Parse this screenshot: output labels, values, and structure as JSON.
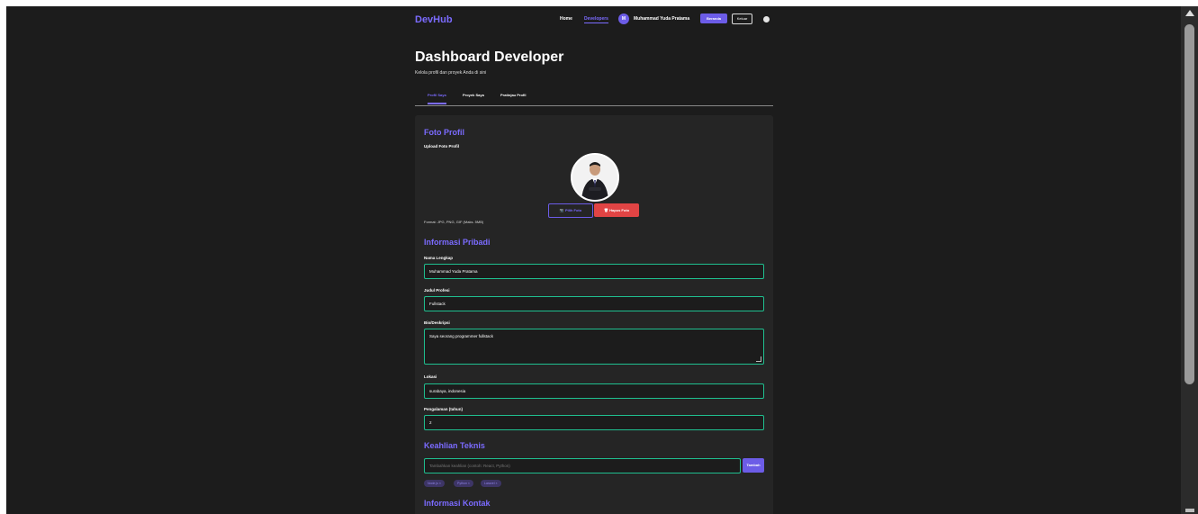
{
  "nav": {
    "logo": "DevHub",
    "home": "Home",
    "developers": "Developers",
    "avatar_initial": "M",
    "user_name": "Muhammad Yuda Pratama",
    "beranda": "Beranda",
    "keluar": "Keluar"
  },
  "header": {
    "title": "Dashboard Developer",
    "subtitle": "Kelola profil dan proyek Anda di sini"
  },
  "tabs": [
    "Profil Saya",
    "Proyek Saya",
    "Pratinjau Profil"
  ],
  "photo": {
    "heading": "Foto Profil",
    "upload_label": "Upload Foto Profil",
    "choose_button": "Pilih Foto",
    "delete_button": "Hapus Foto",
    "format_note": "Format: JPG, PNG, GIF (Maks. 5MB)"
  },
  "personal": {
    "heading": "Informasi Pribadi",
    "name_label": "Nama Lengkap",
    "name_value": "Muhammad Yuda Pratama",
    "title_label": "Judul Profesi",
    "title_value": "Fullstack",
    "bio_label": "Bio/Deskripsi",
    "bio_value": "Saya seorang programmer fullstack",
    "location_label": "Lokasi",
    "location_value": "surabaya, indonesia",
    "experience_label": "Pengalaman (tahun)",
    "experience_value": "2"
  },
  "skills": {
    "heading": "Keahlian Teknis",
    "placeholder": "Tambahkan keahlian (contoh: React, Python)",
    "add_button": "Tambah",
    "chips": [
      "Node.js ×",
      "Python ×",
      "Laravel ×"
    ]
  },
  "contact": {
    "heading": "Informasi Kontak"
  }
}
